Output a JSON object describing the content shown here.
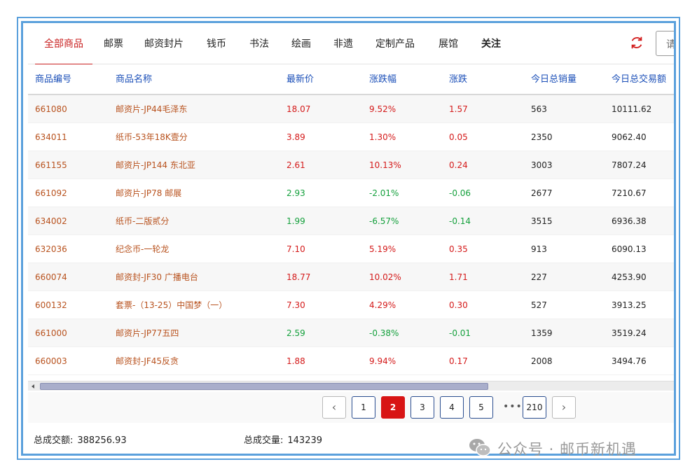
{
  "tabs": [
    {
      "label": "全部商品",
      "active": true
    },
    {
      "label": "邮票"
    },
    {
      "label": "邮资封片"
    },
    {
      "label": "钱币"
    },
    {
      "label": "书法"
    },
    {
      "label": "绘画"
    },
    {
      "label": "非遗"
    },
    {
      "label": "定制产品"
    },
    {
      "label": "展馆"
    },
    {
      "label": "关注"
    }
  ],
  "search": {
    "text": "请"
  },
  "table": {
    "headers": [
      "商品编号",
      "商品名称",
      "最新价",
      "涨跌幅",
      "涨跌",
      "今日总销量",
      "今日总交易额"
    ],
    "rows": [
      {
        "code": "661080",
        "name": "邮资片-JP44毛泽东",
        "price": "18.07",
        "pct": "9.52%",
        "chg": "1.57",
        "vol": "563",
        "amt": "10111.62",
        "dir": "up"
      },
      {
        "code": "634011",
        "name": "纸币-53年18K壹分",
        "price": "3.89",
        "pct": "1.30%",
        "chg": "0.05",
        "vol": "2350",
        "amt": "9062.40",
        "dir": "up"
      },
      {
        "code": "661155",
        "name": "邮资片-JP144 东北亚",
        "price": "2.61",
        "pct": "10.13%",
        "chg": "0.24",
        "vol": "3003",
        "amt": "7807.24",
        "dir": "up"
      },
      {
        "code": "661092",
        "name": "邮资片-JP78 邮展",
        "price": "2.93",
        "pct": "-2.01%",
        "chg": "-0.06",
        "vol": "2677",
        "amt": "7210.67",
        "dir": "down"
      },
      {
        "code": "634002",
        "name": "纸币-二版贰分",
        "price": "1.99",
        "pct": "-6.57%",
        "chg": "-0.14",
        "vol": "3515",
        "amt": "6936.38",
        "dir": "down"
      },
      {
        "code": "632036",
        "name": "纪念币-一轮龙",
        "price": "7.10",
        "pct": "5.19%",
        "chg": "0.35",
        "vol": "913",
        "amt": "6090.13",
        "dir": "up"
      },
      {
        "code": "660074",
        "name": "邮资封-JF30 广播电台",
        "price": "18.77",
        "pct": "10.02%",
        "chg": "1.71",
        "vol": "227",
        "amt": "4253.90",
        "dir": "up"
      },
      {
        "code": "600132",
        "name": "套票-（13-25）中国梦（一）",
        "price": "7.30",
        "pct": "4.29%",
        "chg": "0.30",
        "vol": "527",
        "amt": "3913.25",
        "dir": "up"
      },
      {
        "code": "661000",
        "name": "邮资片-JP77五四",
        "price": "2.59",
        "pct": "-0.38%",
        "chg": "-0.01",
        "vol": "1359",
        "amt": "3519.24",
        "dir": "down"
      },
      {
        "code": "660003",
        "name": "邮资封-JF45反贪",
        "price": "1.88",
        "pct": "9.94%",
        "chg": "0.17",
        "vol": "2008",
        "amt": "3494.76",
        "dir": "up"
      }
    ]
  },
  "pagination": {
    "prev": "‹",
    "next": "›",
    "pages": [
      "1",
      "2",
      "3",
      "4",
      "5"
    ],
    "current": "2",
    "ellipsis": "•••",
    "last": "210"
  },
  "footer": {
    "total_amount_label": "总成交额:",
    "total_amount": "388256.93",
    "total_volume_label": "总成交量:",
    "total_volume": "143239"
  },
  "watermark": {
    "text": "公众号 · 邮币新机遇"
  },
  "colors": {
    "accent": "#c81e1e",
    "up": "#d41a1a",
    "down": "#14a03c",
    "header_text": "#1b4fb8",
    "frame": "#5aa0dc"
  }
}
